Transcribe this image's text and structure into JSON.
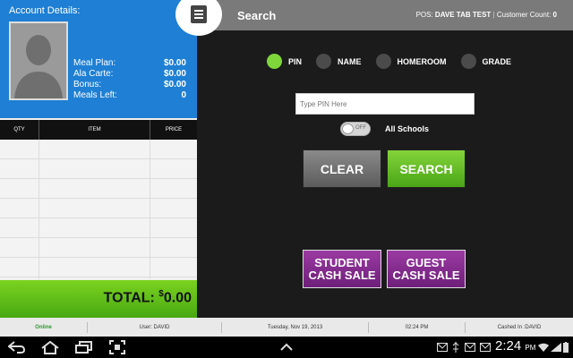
{
  "account": {
    "title": "Account Details:",
    "rows": [
      {
        "label": "Meal Plan:",
        "value": "$0.00"
      },
      {
        "label": "Ala Carte:",
        "value": "$0.00"
      },
      {
        "label": "Bonus:",
        "value": "$0.00"
      },
      {
        "label": "Meals Left:",
        "value": "0"
      }
    ]
  },
  "table": {
    "headers": [
      "QTY",
      "ITEM",
      "PRICE"
    ]
  },
  "total": {
    "label": "TOTAL: ",
    "currency": "$",
    "amount": "0.00"
  },
  "topbar": {
    "title": "Search",
    "pos_label": "POS: ",
    "pos_value": "DAVE TAB TEST",
    "customer_label": "Customer Count: ",
    "customer_value": "0"
  },
  "search": {
    "options": [
      "PIN",
      "NAME",
      "HOMEROOM",
      "GRADE"
    ],
    "selected": "PIN",
    "placeholder": "Type PIN Here",
    "toggle_label": "OFF",
    "all_schools": "All Schools",
    "clear": "CLEAR",
    "search": "SEARCH",
    "student_cash_sale_1": "STUDENT",
    "student_cash_sale_2": "CASH SALE",
    "guest_cash_sale_1": "GUEST",
    "guest_cash_sale_2": "CASH SALE"
  },
  "status": {
    "online": "Online",
    "user": "User: DAVID",
    "date": "Tuesday, Nov 19, 2013",
    "time": "02:24 PM",
    "cashed": "Cashed In :DAVID"
  },
  "system": {
    "clock": "2:24",
    "ampm": "PM"
  },
  "colors": {
    "accent_blue": "#1e7fd4",
    "accent_green": "#7bd320",
    "accent_purple": "#8a2d94"
  }
}
